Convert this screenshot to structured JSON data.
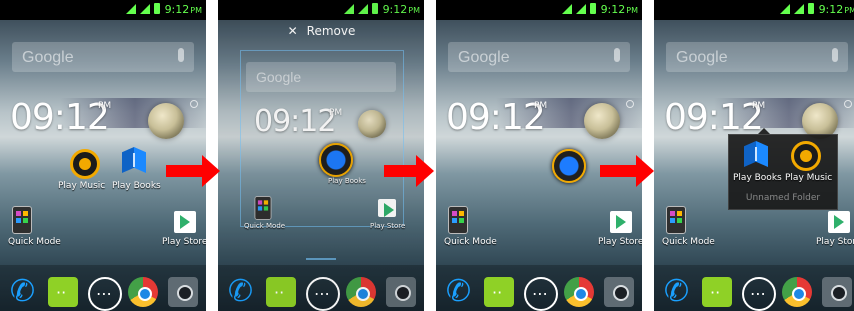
{
  "status_time": "9:12",
  "status_pm": "PM",
  "search_placeholder": "Google",
  "clock": {
    "time": "09:12",
    "pm": "PM"
  },
  "panels": [
    {
      "icons": {
        "play_music": "Play Music",
        "play_books": "Play Books",
        "quick_mode": "Quick Mode",
        "play_store": "Play Store"
      }
    },
    {
      "remove_label": "Remove",
      "icons": {
        "quick_mode": "Quick Mode",
        "play_store": "Play Store",
        "play_books": "Play Books"
      }
    },
    {
      "icons": {
        "quick_mode": "Quick Mode",
        "play_store": "Play Store"
      }
    },
    {
      "folder_title": "Unnamed Folder",
      "icons": {
        "play_books": "Play Books",
        "play_music": "Play Music",
        "quick_mode": "Quick Mode",
        "play_store": "Play Store"
      }
    }
  ],
  "dock_icons": [
    "phone-icon",
    "messaging-icon",
    "app-drawer-icon",
    "chrome-icon",
    "camera-icon"
  ],
  "colors": {
    "status_green": "#64ff4e",
    "arrow_red": "#ff0000",
    "music_orange": "#f2a900",
    "books_blue": "#1b89ff"
  }
}
